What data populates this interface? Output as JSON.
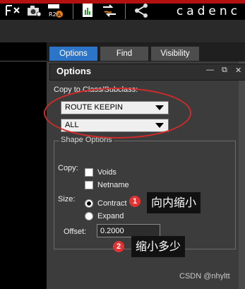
{
  "app": {
    "brand": "cadenc"
  },
  "tabs": [
    {
      "label": "Options",
      "active": true
    },
    {
      "label": "Find",
      "active": false
    },
    {
      "label": "Visibility",
      "active": false
    }
  ],
  "panel": {
    "title": "Options",
    "controls": {
      "minimize": "—",
      "restore": "⧉",
      "close": "✕"
    },
    "copy_to_label": "Copy to Class/Subclass:",
    "class_value": "ROUTE KEEPIN",
    "subclass_value": "ALL",
    "shape_options": {
      "legend": "Shape Options",
      "copy_label": "Copy:",
      "voids_label": "Voids",
      "voids_checked": false,
      "netname_label": "Netname",
      "netname_checked": false,
      "size_label": "Size:",
      "contract_label": "Contract",
      "contract_checked": true,
      "expand_label": "Expand",
      "expand_checked": false,
      "offset_label": "Offset:",
      "offset_value": "0.2000"
    }
  },
  "annotations": {
    "callout1_number": "1",
    "callout1_text": "向内缩小",
    "callout2_number": "2",
    "callout2_text": "缩小多少",
    "highlight_color": "#d42a2a"
  },
  "watermark": "CSDN @nhyltt"
}
